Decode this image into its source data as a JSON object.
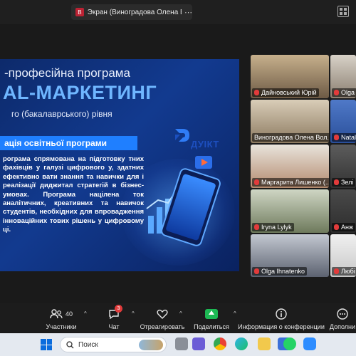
{
  "window": {
    "share_label": "Экран (Виноградова Олена Волод",
    "share_avatar": "B"
  },
  "slide": {
    "line1": "-професійна програма",
    "line2": "AL-МАРКЕТИНГ",
    "line3": "го (бакалаврського) рівня",
    "logo_text": "ДУІКТ",
    "banner": "ація освітньої програми",
    "body": "рограма спрямована на підготовку тних фахівців у галузі цифрового у, здатних ефективно вати знання та навички для і реалізації диджитал стратегій в бізнес-умовах. Програма націлена ток аналітичних, креативних та навичок студентів, необхідних для впровадження інноваційних тових рішень у цифровому ці."
  },
  "participants": [
    {
      "name": "Дайновський Юрій",
      "muted": true
    },
    {
      "name": "Olga",
      "muted": true
    },
    {
      "name": "Виноградова Олена Вол...",
      "muted": false
    },
    {
      "name": "Natal",
      "muted": true
    },
    {
      "name": "Маргарита Лишенко (...",
      "muted": true
    },
    {
      "name": "Зелі",
      "muted": true
    },
    {
      "name": "Iryna Lylyk",
      "muted": true
    },
    {
      "name": "Анж",
      "muted": true
    },
    {
      "name": "Olga Ihnatenko",
      "muted": true
    },
    {
      "name": "Любі",
      "muted": true
    }
  ],
  "toolbar": {
    "participants_label": "Участники",
    "participants_count": "40",
    "chat_label": "Чат",
    "chat_badge": "3",
    "react_label": "Отреагировать",
    "share_label": "Поделиться",
    "info_label": "Информация о конференции",
    "more_label": "Дополни"
  },
  "taskbar": {
    "search_placeholder": "Поиск"
  },
  "colors": {
    "accent_blue": "#1f7fff",
    "share_green": "#1db954",
    "mute_red": "#e23b3b"
  }
}
